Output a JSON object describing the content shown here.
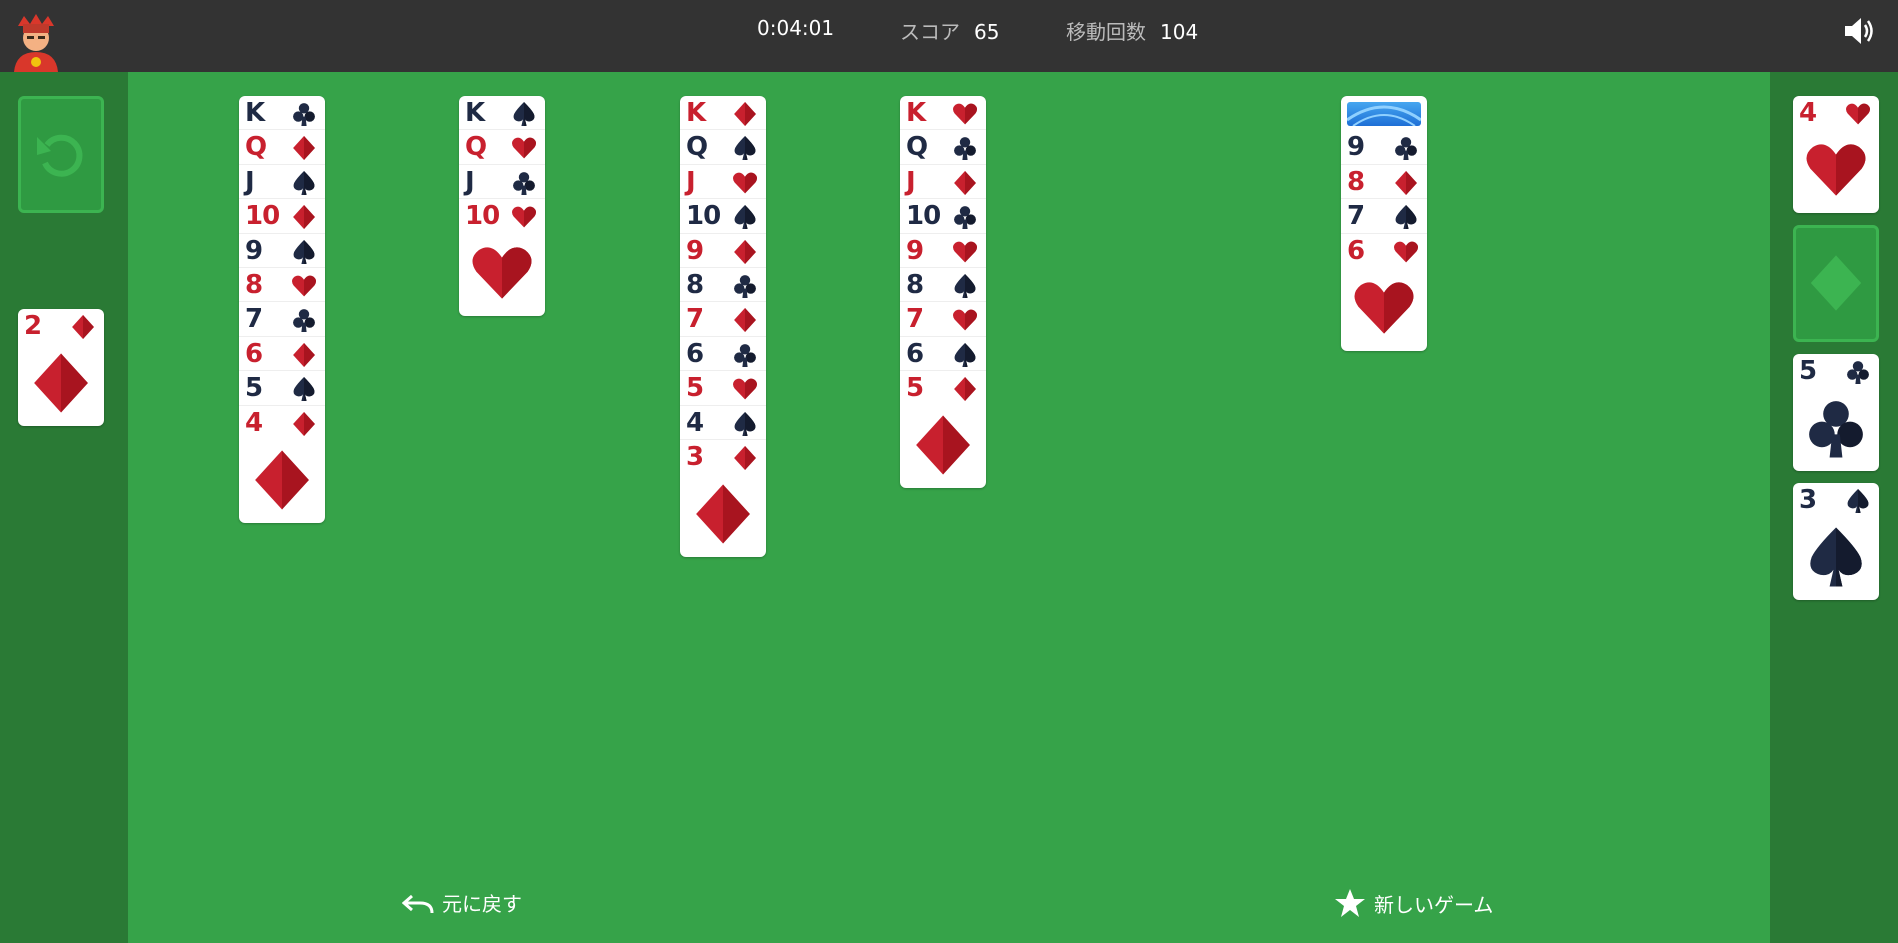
{
  "colors": {
    "red": "#c8202e",
    "dark": "#1f2a44",
    "field": "#36a349",
    "topbar": "#333333"
  },
  "stats": {
    "time": "0:04:01",
    "score_label": "スコア",
    "score": "65",
    "moves_label": "移動回数",
    "moves": "104"
  },
  "buttons": {
    "undo": "元に戻す",
    "new_game": "新しいゲーム"
  },
  "icons": {
    "avatar": "avatar-icon",
    "sound": "speaker-icon",
    "undo": "undo-arrow-icon",
    "new_game": "star-icon",
    "stock": "recycle-icon"
  },
  "waste": [
    {
      "rank": "2",
      "suit": "diamond"
    }
  ],
  "tableau": [
    {
      "cards": [
        {
          "rank": "K",
          "suit": "club"
        },
        {
          "rank": "Q",
          "suit": "diamond"
        },
        {
          "rank": "J",
          "suit": "spade"
        },
        {
          "rank": "10",
          "suit": "diamond"
        },
        {
          "rank": "9",
          "suit": "spade"
        },
        {
          "rank": "8",
          "suit": "heart"
        },
        {
          "rank": "7",
          "suit": "club"
        },
        {
          "rank": "6",
          "suit": "diamond"
        },
        {
          "rank": "5",
          "suit": "spade"
        },
        {
          "rank": "4",
          "suit": "diamond"
        }
      ]
    },
    {
      "cards": [
        {
          "rank": "K",
          "suit": "spade"
        },
        {
          "rank": "Q",
          "suit": "heart"
        },
        {
          "rank": "J",
          "suit": "club"
        },
        {
          "rank": "10",
          "suit": "heart"
        }
      ]
    },
    {
      "cards": [
        {
          "rank": "K",
          "suit": "diamond"
        },
        {
          "rank": "Q",
          "suit": "spade"
        },
        {
          "rank": "J",
          "suit": "heart"
        },
        {
          "rank": "10",
          "suit": "spade"
        },
        {
          "rank": "9",
          "suit": "diamond"
        },
        {
          "rank": "8",
          "suit": "club"
        },
        {
          "rank": "7",
          "suit": "diamond"
        },
        {
          "rank": "6",
          "suit": "club"
        },
        {
          "rank": "5",
          "suit": "heart"
        },
        {
          "rank": "4",
          "suit": "spade"
        },
        {
          "rank": "3",
          "suit": "diamond"
        }
      ]
    },
    {
      "cards": [
        {
          "rank": "K",
          "suit": "heart"
        },
        {
          "rank": "Q",
          "suit": "club"
        },
        {
          "rank": "J",
          "suit": "diamond"
        },
        {
          "rank": "10",
          "suit": "club"
        },
        {
          "rank": "9",
          "suit": "heart"
        },
        {
          "rank": "8",
          "suit": "spade"
        },
        {
          "rank": "7",
          "suit": "heart"
        },
        {
          "rank": "6",
          "suit": "spade"
        },
        {
          "rank": "5",
          "suit": "diamond"
        }
      ]
    },
    {
      "facedown": 1,
      "cards": [
        {
          "rank": "9",
          "suit": "club"
        },
        {
          "rank": "8",
          "suit": "diamond"
        },
        {
          "rank": "7",
          "suit": "spade"
        },
        {
          "rank": "6",
          "suit": "heart"
        }
      ]
    }
  ],
  "foundations": [
    {
      "rank": "4",
      "suit": "heart"
    },
    {
      "empty": true,
      "suit": "diamond"
    },
    {
      "rank": "5",
      "suit": "club"
    },
    {
      "rank": "3",
      "suit": "spade"
    }
  ]
}
